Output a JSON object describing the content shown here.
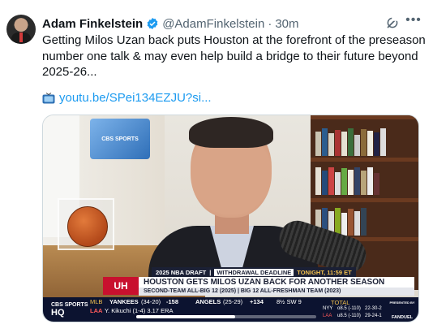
{
  "tweet": {
    "author_name": "Adam Finkelstein",
    "handle": "@AdamFinkelstein",
    "separator": "·",
    "timestamp": "30m",
    "text_lines": [
      "Getting Milos Uzan back puts Houston at the forefront of the preseason",
      "number one talk & may even help build a bridge to their future beyond",
      "2025-26..."
    ],
    "link_text": "youtu.be/SPei134EZJU?si...",
    "icons": {
      "verified": "verified-badge-icon",
      "grok": "grok-icon",
      "more": "more-options-icon",
      "tv": "television-icon"
    },
    "colors": {
      "link": "#1d9bf0",
      "verified": "#1d9bf0",
      "secondary_text": "#536471"
    }
  },
  "video": {
    "backdrop_sign": "CBS SPORTS",
    "tag_left": "2025 NBA DRAFT",
    "tag_middle": "WITHDRAWAL DEADLINE",
    "tag_right": "TONIGHT, 11:59 ET",
    "team_logo": "UH",
    "headline": "HOUSTON GETS MILOS UZAN BACK FOR ANOTHER SEASON",
    "subline": "SECOND-TEAM ALL-BIG 12 (2025) | BIG 12 ALL-FRESHMAN TEAM (2023)",
    "network_small": "CBS SPORTS",
    "network_big": "HQ",
    "ticker": {
      "league": "MLB",
      "team1": "YANKEES",
      "team1_record": "(34-20)",
      "team1_odds": "-158",
      "team2": "ANGELS",
      "team2_record": "(25-29)",
      "team2_odds": "+134",
      "total": "8½ SW 9",
      "row2_team": "LAA",
      "row2_pitcher": "Y. Kikuchi (1-4) 3.17 ERA",
      "board_header": "TOTAL",
      "board_rows": [
        {
          "team": "NYY",
          "col1": "o8.5 (-110)",
          "col2": "22-30-2"
        },
        {
          "team": "LAA",
          "col1": "u8.5 (-110)",
          "col2": "29-24-1"
        }
      ],
      "presented_by": "PRESENTED BY",
      "sponsor": "FANDUEL"
    },
    "playback_progress_fraction": 0.55
  }
}
